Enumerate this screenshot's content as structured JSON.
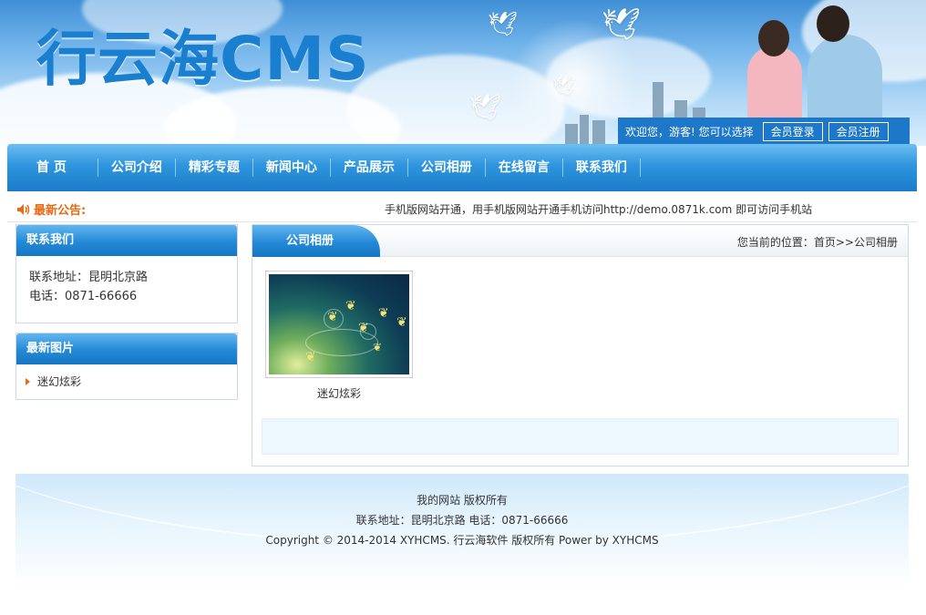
{
  "header": {
    "logo_text": "行云海CMS",
    "welcome_text": "欢迎您，游客! 您可以选择",
    "login_label": "会员登录",
    "register_label": "会员注册"
  },
  "nav": {
    "items": [
      "首 页",
      "公司介绍",
      "精彩专题",
      "新闻中心",
      "产品展示",
      "公司相册",
      "在线留言",
      "联系我们"
    ]
  },
  "notice": {
    "label": "最新公告:",
    "text": "手机版网站开通，用手机版网站开通手机访问http://demo.0871k.com 即可访问手机站"
  },
  "sidebar": {
    "contact": {
      "title": "联系我们",
      "address": "联系地址：昆明北京路",
      "phone": "电话：0871-66666"
    },
    "latest_pics": {
      "title": "最新图片",
      "items": [
        "迷幻炫彩"
      ]
    }
  },
  "main": {
    "tab_title": "公司相册",
    "breadcrumb": "您当前的位置：首页>>公司相册",
    "photos": [
      {
        "caption": "迷幻炫彩"
      }
    ]
  },
  "footer": {
    "line1": "我的网站 版权所有",
    "line2": "联系地址：昆明北京路 电话：0871-66666",
    "line3": "Copyright © 2014-2014 XYHCMS. 行云海软件 版权所有   Power by XYHCMS"
  },
  "colors": {
    "brand_blue": "#1b7fd0",
    "nav_blue": "#2f95de",
    "notice_orange": "#e86a12"
  }
}
